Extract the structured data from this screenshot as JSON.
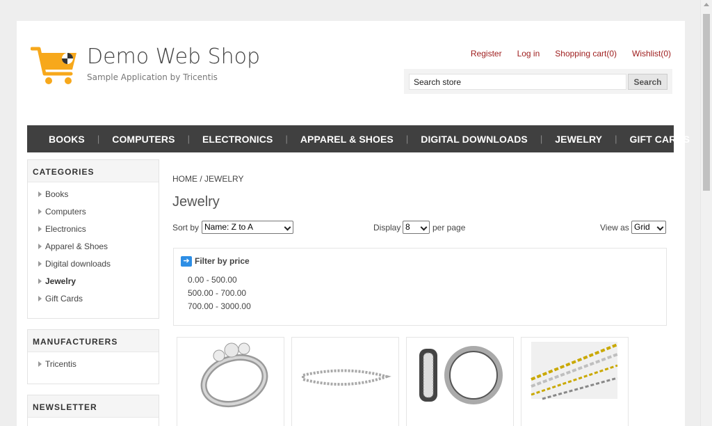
{
  "header": {
    "title": "Demo Web Shop",
    "subtitle": "Sample Application by Tricentis",
    "links": {
      "register": "Register",
      "login": "Log in",
      "cart": "Shopping cart(0)",
      "wishlist": "Wishlist(0)"
    },
    "search_placeholder": "Search store",
    "search_button": "Search"
  },
  "top_menu": [
    "BOOKS",
    "COMPUTERS",
    "ELECTRONICS",
    "APPAREL & SHOES",
    "DIGITAL DOWNLOADS",
    "JEWELRY",
    "GIFT CARDS"
  ],
  "categories": {
    "title": "CATEGORIES",
    "items": [
      "Books",
      "Computers",
      "Electronics",
      "Apparel & Shoes",
      "Digital downloads",
      "Jewelry",
      "Gift Cards"
    ],
    "active": "Jewelry"
  },
  "manufacturers": {
    "title": "MANUFACTURERS",
    "items": [
      "Tricentis"
    ]
  },
  "newsletter": {
    "title": "NEWSLETTER"
  },
  "breadcrumb": {
    "home": "HOME",
    "separator": " / ",
    "current": "JEWELRY"
  },
  "main": {
    "heading": "Jewelry",
    "sort_label": "Sort by",
    "sort_value": "Name: Z to A",
    "display_label": "Display",
    "display_value": "8",
    "per_page_label": "per page",
    "view_label": "View as",
    "view_value": "Grid",
    "filter_title": "Filter by price",
    "price_ranges": [
      "0.00 - 500.00",
      "500.00 - 700.00",
      "700.00 - 3000.00"
    ]
  },
  "colors": {
    "link_red": "#9d1b1b",
    "menu_bg": "#404040",
    "logo_orange": "#f7a81b",
    "filter_blue": "#2d8ee5"
  },
  "products": [
    "ring",
    "bracelet",
    "earrings",
    "chains"
  ]
}
